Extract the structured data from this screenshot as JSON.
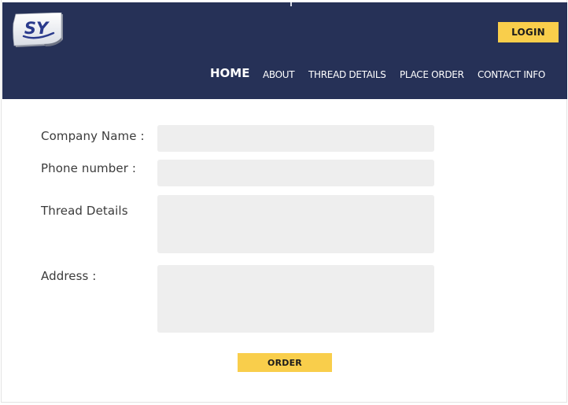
{
  "header": {
    "logo_text": "SY",
    "login_label": "LOGIN"
  },
  "nav": {
    "items": [
      {
        "label": "HOME"
      },
      {
        "label": "ABOUT"
      },
      {
        "label": "THREAD DETAILS"
      },
      {
        "label": "PLACE ORDER"
      },
      {
        "label": "CONTACT INFO"
      }
    ]
  },
  "form": {
    "company_name_label": "Company Name :",
    "company_name_value": "",
    "phone_label": "Phone number :",
    "phone_value": "",
    "thread_details_label": "Thread Details",
    "thread_details_value": "",
    "address_label": "Address :",
    "address_value": "",
    "order_label": "ORDER"
  },
  "colors": {
    "header_bg": "#263157",
    "accent": "#f9ce4b",
    "field_bg": "#eeeeee",
    "label_text": "#3b3b3b"
  }
}
